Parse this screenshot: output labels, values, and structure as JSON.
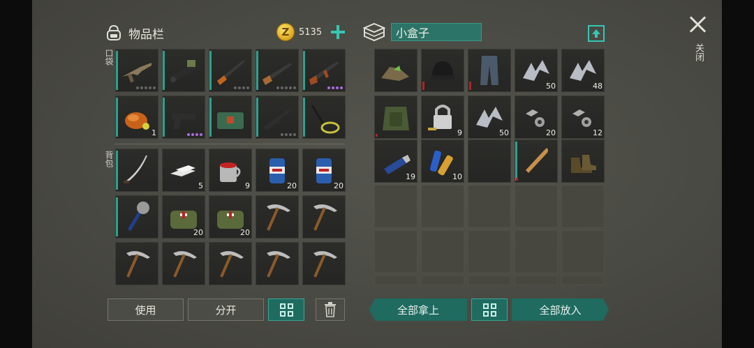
{
  "inventory": {
    "title": "物品栏",
    "coins": "5135"
  },
  "sections": {
    "pocket": "口袋",
    "backpack": "背包"
  },
  "box": {
    "title": "小盒子"
  },
  "close_label": "关闭",
  "buttons": {
    "use": "使用",
    "split": "分开",
    "take_all": "全部拿上",
    "put_all": "全部放入"
  },
  "pocket_items": [
    {
      "icon": "assault-rifle-icon",
      "count": "",
      "dots": 5
    },
    {
      "icon": "rocket-launcher-icon",
      "count": "",
      "dots": 0
    },
    {
      "icon": "hunting-rifle-icon",
      "count": "",
      "dots": 4
    },
    {
      "icon": "shotgun-icon",
      "count": "",
      "dots": 5
    },
    {
      "icon": "ak-rifle-icon",
      "count": "",
      "dots": 4,
      "purple": true
    },
    {
      "icon": "roast-chicken-icon",
      "count": "1",
      "dots": 0
    },
    {
      "icon": "pistol-icon",
      "count": "",
      "dots": 4,
      "purple": true
    },
    {
      "icon": "medkit-bag-icon",
      "count": "",
      "dots": 0
    },
    {
      "icon": "m4-rifle-icon",
      "count": "",
      "dots": 4
    },
    {
      "icon": "metal-detector-icon",
      "count": "",
      "dots": 0
    }
  ],
  "backpack_items": [
    {
      "icon": "katana-icon",
      "count": ""
    },
    {
      "icon": "silver-bars-icon",
      "count": "5"
    },
    {
      "icon": "red-mug-icon",
      "count": "9"
    },
    {
      "icon": "beer-can-icon",
      "count": "20"
    },
    {
      "icon": "beer-can-icon",
      "count": "20"
    },
    {
      "icon": "saw-club-icon",
      "count": ""
    },
    {
      "icon": "first-aid-bag-icon",
      "count": "20"
    },
    {
      "icon": "first-aid-bag-icon",
      "count": "20"
    },
    {
      "icon": "pickaxe-icon",
      "count": ""
    },
    {
      "icon": "pickaxe-icon",
      "count": ""
    },
    {
      "icon": "pickaxe-icon",
      "count": ""
    },
    {
      "icon": "pickaxe-icon",
      "count": ""
    },
    {
      "icon": "pickaxe-icon",
      "count": ""
    },
    {
      "icon": "pickaxe-icon",
      "count": ""
    },
    {
      "icon": "pickaxe-icon",
      "count": ""
    }
  ],
  "box_items": [
    {
      "icon": "scrap-pile-icon",
      "count": ""
    },
    {
      "icon": "beanie-icon",
      "count": ""
    },
    {
      "icon": "pants-icon",
      "count": ""
    },
    {
      "icon": "metal-scrap-icon",
      "count": "50"
    },
    {
      "icon": "metal-scrap-icon",
      "count": "48"
    },
    {
      "icon": "body-armor-icon",
      "count": ""
    },
    {
      "icon": "padlock-icon",
      "count": "9"
    },
    {
      "icon": "metal-scrap-icon",
      "count": "50"
    },
    {
      "icon": "nuts-bolts-icon",
      "count": "20"
    },
    {
      "icon": "nuts-bolts-icon",
      "count": "12"
    },
    {
      "icon": "usb-drive-icon",
      "count": "19"
    },
    {
      "icon": "batteries-icon",
      "count": "10"
    },
    {
      "icon": "",
      "count": ""
    },
    {
      "icon": "baseball-bat-icon",
      "count": ""
    },
    {
      "icon": "boots-icon",
      "count": ""
    }
  ],
  "colors": {
    "accent": "#35c7b3",
    "button_teal": "#1f6b60",
    "coin": "#e0b020"
  }
}
